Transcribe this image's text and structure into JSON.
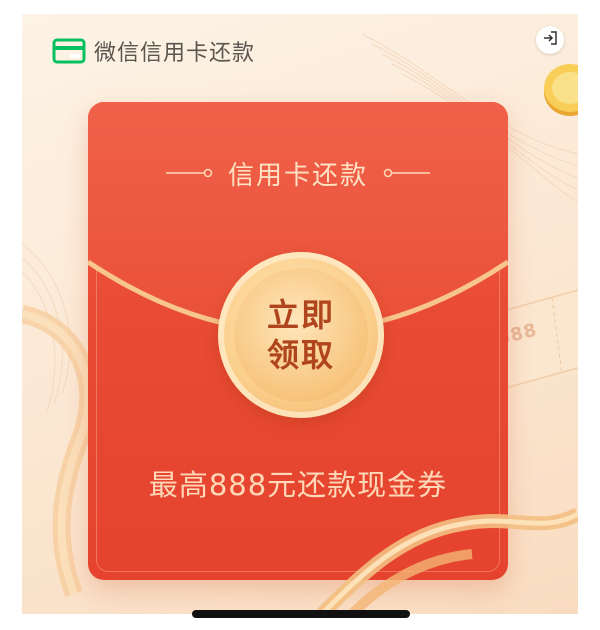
{
  "header": {
    "brand_title": "微信信用卡还款"
  },
  "icons": {
    "brand_logo": "wechat-card-icon",
    "exit": "exit-icon",
    "coin": "gold-coin-icon"
  },
  "decor": {
    "coupon_text": "888"
  },
  "envelope": {
    "title": "信用卡还款",
    "open_button_line1": "立即",
    "open_button_line2": "领取",
    "subtitle": "最高888元还款现金券"
  },
  "colors": {
    "brand_green": "#07c160",
    "envelope_red": "#e84a33",
    "gold": "#f7c47c",
    "button_text": "#b0441d"
  }
}
